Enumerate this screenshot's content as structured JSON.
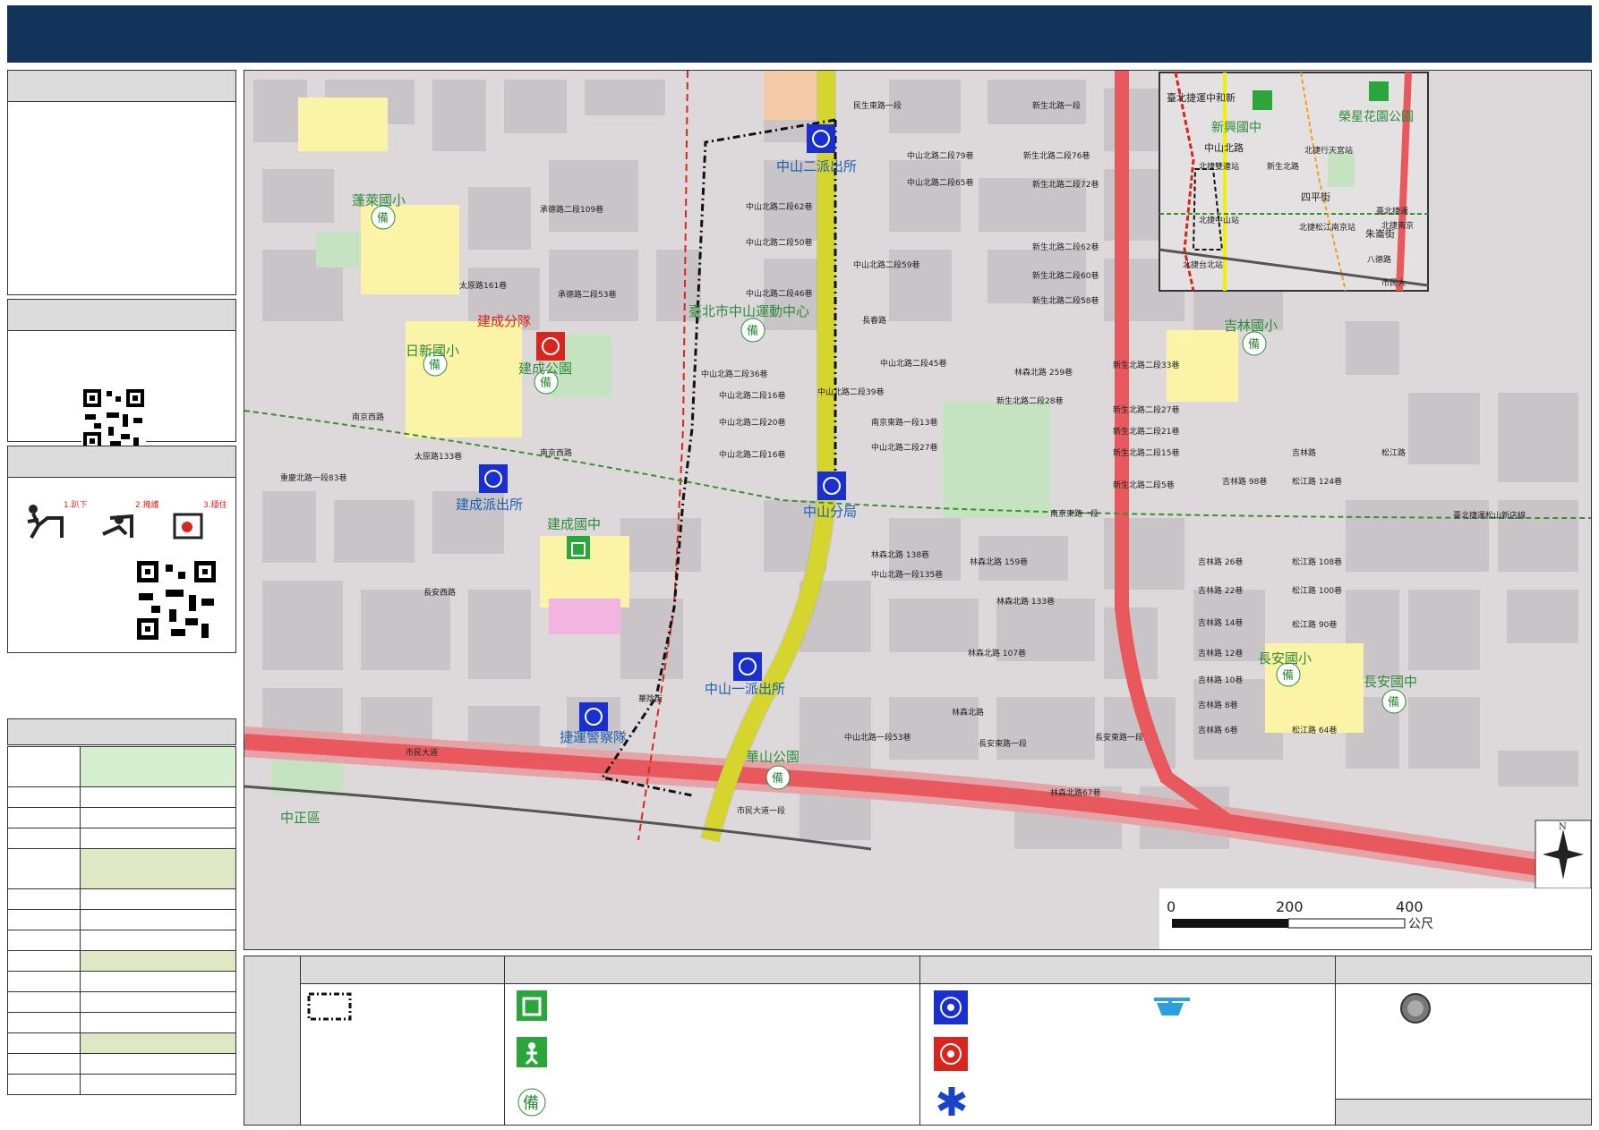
{
  "colors": {
    "header": "#12335a",
    "road_main": "#f0f000",
    "road_red": "#e8585c",
    "block": "#c9c4c7",
    "school": "#fbf3a6",
    "park": "#c5e3c1",
    "police": "#1a2fd0",
    "fire": "#d8261e"
  },
  "map": {
    "labels": {
      "l1": "蓬萊國小",
      "l2": "日新國小",
      "l3": "建成公園",
      "l4": "建成分隊",
      "l5": "中山二派出所",
      "l6": "臺北市中山運動中心",
      "l7": "建成派出所",
      "l8": "建成國中",
      "l9": "中山分局",
      "l10": "中山一派出所",
      "l11": "捷運警察隊",
      "l12": "華山公園",
      "l13": "吉林國小",
      "l14": "長安國小",
      "l15": "長安國中",
      "l16": "中正區"
    },
    "streets": {
      "s1": "中山北路二段79巷",
      "s2": "新生北路二段76巷",
      "s3": "中山北路二段65巷",
      "s4": "新生北路二段72巷",
      "s5": "中山北路二段62巷",
      "s6": "承德路二段109巷",
      "s7": "中山北路二段50巷",
      "s8": "新生北路二段62巷",
      "s9": "中山北路二段59巷",
      "s10": "中山北路二段46巷",
      "s11": "新生北路二段60巷",
      "s12": "新生北路二段58巷",
      "s13": "中山北路二段45巷",
      "s14": "中山北路二段36巷",
      "s15": "中山北路二段39巷",
      "s16": "中山北路二段16巷",
      "s17": "中山北路二段20巷",
      "s18": "南京東路一段13巷",
      "s19": "中山北路二段27巷",
      "s20": "中山北路二段16巷",
      "s21": "南京西路",
      "s22": "南京東路一段",
      "s23": "太原路133巷",
      "s24": "重慶北路一段83巷",
      "s25": "長安西路",
      "s26": "長安東路一段",
      "s27": "市民大道",
      "s28": "市民大道一段",
      "s29": "林森北路",
      "s30": "吉林路",
      "s31": "松江路",
      "s32": "長春路",
      "s33": "民生東路一段",
      "s34": "新生北路一段",
      "s35": "太原路161巷",
      "s36": "承德路二段53巷",
      "s37": "南京西路",
      "s38": "華陰街",
      "s39": "中山北路一段53巷",
      "s40": "臺北捷運松山新店線"
    },
    "streets_right": {
      "r1": "松江路 124巷",
      "r2": "吉林路 98巷",
      "r3": "吉林路 26巷",
      "r4": "松江路 108巷",
      "r5": "吉林路 22巷",
      "r6": "松江路 100巷",
      "r7": "吉林路 14巷",
      "r8": "松江路 90巷",
      "r9": "吉林路 12巷",
      "r10": "吉林路 10巷",
      "r11": "吉林路 8巷",
      "r12": "吉林路 6巷",
      "r13": "松江路 64巷",
      "r14": "林森北路 159巷",
      "r15": "林森北路 138巷",
      "r16": "中山北路一段135巷",
      "r17": "林森北路 133巷",
      "r18": "林森北路 107巷",
      "r19": "長安東路一段",
      "r20": "林森北路67巷",
      "r21": "新生北路二段33巷",
      "r22": "新生北路二段27巷",
      "r23": "新生北路二段21巷",
      "r24": "新生北路二段15巷",
      "r25": "新生北路二段5巷",
      "r26": "新生北路二段28巷",
      "r27": "林森北路 259巷"
    },
    "inset": {
      "i1": "臺北捷運中和新",
      "i2": "新興國中",
      "i3": "榮星花園公園",
      "i4": "中山北路",
      "i5": "北捷雙連站",
      "i6": "北捷中山站",
      "i7": "四平街",
      "i8": "北捷松江南京站",
      "i9": "朱崙街",
      "i10": "北捷行天宮站",
      "i11": "臺北捷運",
      "i12": "北捷南京",
      "i13": "新生北路",
      "i14": "八德路",
      "i15": "北捷台北站",
      "i16": "市民大"
    },
    "scale": {
      "s0": "0",
      "s200": "200",
      "s400": "400",
      "unit": "公尺"
    },
    "compass": "N"
  },
  "legend": {
    "symbols": [
      "evac-route",
      "shelter-exit",
      "evac-green",
      "reserve",
      "police",
      "fire-dept",
      "medical",
      "helipad",
      "assembly-point"
    ]
  }
}
